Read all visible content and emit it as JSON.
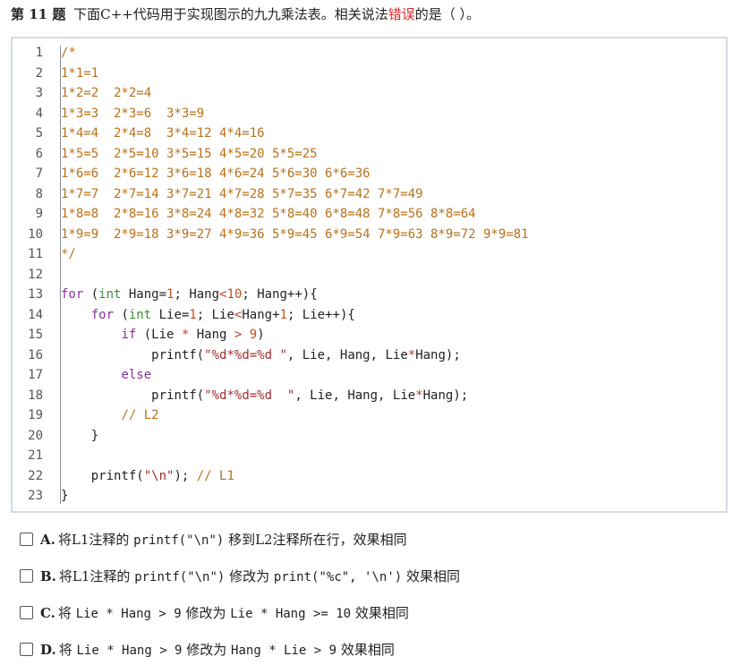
{
  "question": {
    "number_label": "第 11 题",
    "text_before": "下面C++代码用于实现图示的九九乘法表。相关说法",
    "text_highlight": "错误",
    "text_after": "的是（ ）。",
    "highlight_color": "#e0262b"
  },
  "code": {
    "line_numbers": [
      "1",
      "2",
      "3",
      "4",
      "5",
      "6",
      "7",
      "8",
      "9",
      "10",
      "11",
      "12",
      "13",
      "14",
      "15",
      "16",
      "17",
      "18",
      "19",
      "20",
      "21",
      "22",
      "23"
    ],
    "comment_lines": [
      "/*",
      "1*1=1",
      "1*2=2  2*2=4",
      "1*3=3  2*3=6  3*3=9",
      "1*4=4  2*4=8  3*4=12 4*4=16",
      "1*5=5  2*5=10 3*5=15 4*5=20 5*5=25",
      "1*6=6  2*6=12 3*6=18 4*6=24 5*6=30 6*6=36",
      "1*7=7  2*7=14 3*7=21 4*7=28 5*7=35 6*7=42 7*7=49",
      "1*8=8  2*8=16 3*8=24 4*8=32 5*8=40 6*8=48 7*8=56 8*8=64",
      "1*9=9  2*9=18 3*9=27 4*9=36 5*9=45 6*9=54 7*9=63 8*9=72 9*9=81",
      "*/"
    ],
    "line13": {
      "kw": "for",
      "p1": " (",
      "ty": "int",
      "p2": " Hang=",
      "n1": "1",
      "p3": "; Hang",
      "op": "<",
      "n2": "10",
      "p4": "; Hang++){"
    },
    "line14": {
      "indent": "    ",
      "kw": "for",
      "p1": " (",
      "ty": "int",
      "p2": " Lie=",
      "n1": "1",
      "p3": "; Lie",
      "op": "<",
      "p4": "Hang+",
      "n2": "1",
      "p5": "; Lie++){"
    },
    "line15": {
      "indent": "        ",
      "kw": "if",
      "p1": " (Lie ",
      "op1": "*",
      "p2": " Hang ",
      "op2": ">",
      "p3": " ",
      "n": "9",
      "p4": ")"
    },
    "line16": {
      "indent": "            ",
      "fn": "printf(",
      "str": "\"%d*%d=%d \"",
      "rest": ", Lie, Hang, Lie",
      "op": "*",
      "end": "Hang);"
    },
    "line17": {
      "indent": "        ",
      "kw": "else"
    },
    "line18": {
      "indent": "            ",
      "fn": "printf(",
      "str": "\"%d*%d=%d  \"",
      "rest": ", Lie, Hang, Lie",
      "op": "*",
      "end": "Hang);"
    },
    "line19": {
      "indent": "        ",
      "comment": "// L2"
    },
    "line20": {
      "indent": "    ",
      "text": "}"
    },
    "line22": {
      "indent": "    ",
      "fn": "printf(",
      "str": "\"\\n\"",
      "rest": "); ",
      "comment": "// L1"
    },
    "line23": {
      "text": "}"
    }
  },
  "options": [
    {
      "letter": "A.",
      "parts": [
        {
          "t": "将L1注释的 ",
          "mono": false
        },
        {
          "t": "printf(\"\\n\")",
          "mono": true
        },
        {
          "t": " 移到L2注释所在行，效果相同",
          "mono": false
        }
      ]
    },
    {
      "letter": "B.",
      "parts": [
        {
          "t": "将L1注释的 ",
          "mono": false
        },
        {
          "t": "printf(\"\\n\")",
          "mono": true
        },
        {
          "t": " 修改为 ",
          "mono": false
        },
        {
          "t": "print(\"%c\", '\\n')",
          "mono": true
        },
        {
          "t": " 效果相同",
          "mono": false
        }
      ]
    },
    {
      "letter": "C.",
      "parts": [
        {
          "t": "将 ",
          "mono": false
        },
        {
          "t": "Lie * Hang > 9",
          "mono": true
        },
        {
          "t": " 修改为 ",
          "mono": false
        },
        {
          "t": "Lie * Hang >= 10",
          "mono": true
        },
        {
          "t": " 效果相同",
          "mono": false
        }
      ]
    },
    {
      "letter": "D.",
      "parts": [
        {
          "t": "将 ",
          "mono": false
        },
        {
          "t": "Lie * Hang > 9",
          "mono": true
        },
        {
          "t": " 修改为 ",
          "mono": false
        },
        {
          "t": "Hang * Lie > 9",
          "mono": true
        },
        {
          "t": " 效果相同",
          "mono": false
        }
      ]
    }
  ]
}
